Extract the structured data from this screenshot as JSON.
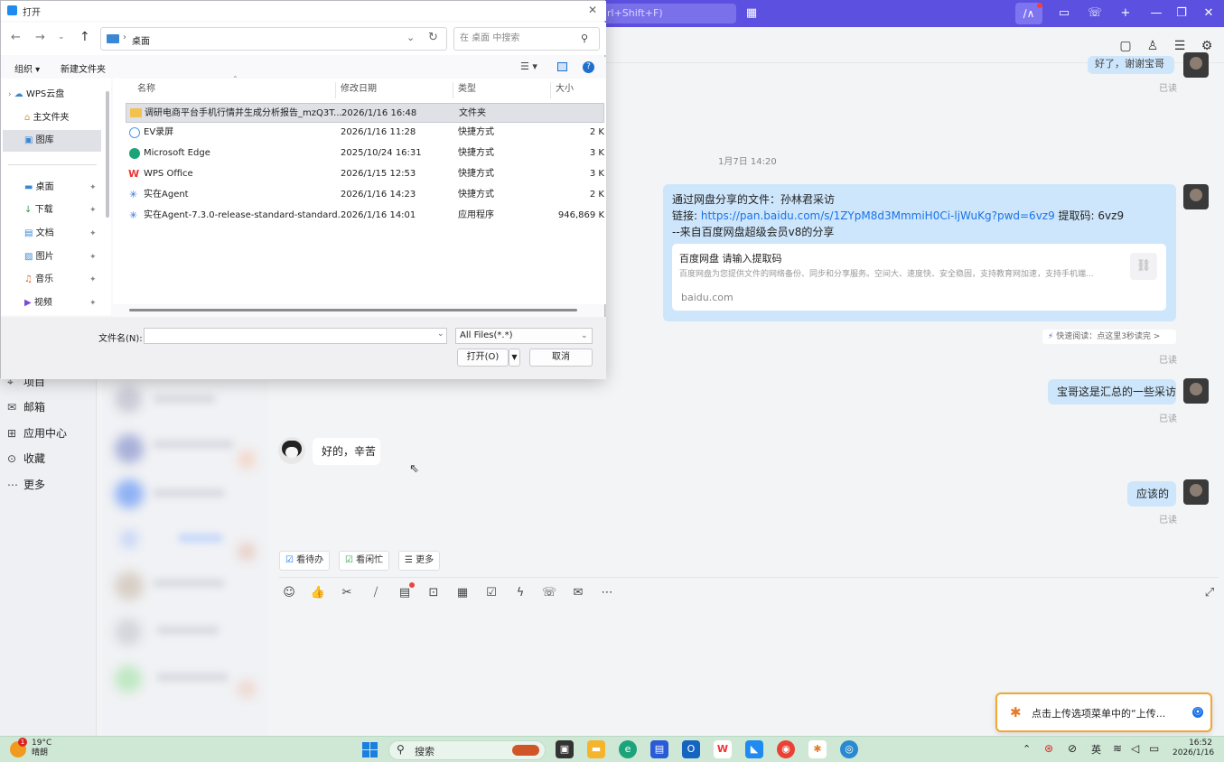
{
  "app": {
    "search_hint": "rl+Shift+F)",
    "sidebar": [
      {
        "label": "项目",
        "icon": "tag-icon"
      },
      {
        "label": "邮箱",
        "icon": "mail-icon"
      },
      {
        "label": "应用中心",
        "icon": "apps-icon"
      },
      {
        "label": "收藏",
        "icon": "star-icon"
      },
      {
        "label": "更多",
        "icon": "more-icon"
      }
    ],
    "partial_top_msg": "好了，谢谢宝哥",
    "read_label": "已读",
    "timestamp": "1月7日 14:20",
    "share_msg": {
      "line1": "通过网盘分享的文件：孙林君采访",
      "link_prefix": "链接: ",
      "link_url": "https://pan.baidu.com/s/1ZYpM8d3MmmiH0Ci-ljWuKg?pwd=6vz9",
      "code": " 提取码: 6vz9",
      "line3": "--来自百度网盘超级会员v8的分享",
      "card_title": "百度网盘 请输入提取码",
      "card_desc": "百度网盘为您提供文件的网络备份、同步和分享服务。空间大、速度快、安全稳固，支持教育网加速，支持手机端...",
      "card_domain": "baidu.com"
    },
    "quick_read": "快速阅读：点这里3秒读完 >",
    "msg_summary": "宝哥这是汇总的一些采访",
    "msg_reply": "好的，辛苦",
    "msg_should": "应该的",
    "tags": [
      "看待办",
      "看闲忙",
      "更多"
    ],
    "toast": "点击上传选项菜单中的“上传..."
  },
  "dialog": {
    "title": "打开",
    "address": "桌面",
    "search_placeholder": "在 桌面 中搜索",
    "organize": "组织 ▾",
    "new_folder": "新建文件夹",
    "tree": [
      {
        "label": "WPS云盘",
        "icon": "cloud-icon"
      },
      {
        "label": "主文件夹",
        "icon": "home-icon"
      },
      {
        "label": "图库",
        "icon": "gallery-icon"
      },
      {
        "label": "桌面",
        "icon": "desktop-icon"
      },
      {
        "label": "下载",
        "icon": "download-icon"
      },
      {
        "label": "文档",
        "icon": "document-icon"
      },
      {
        "label": "图片",
        "icon": "picture-icon"
      },
      {
        "label": "音乐",
        "icon": "music-icon"
      },
      {
        "label": "视频",
        "icon": "video-icon"
      }
    ],
    "columns": [
      "名称",
      "修改日期",
      "类型",
      "大小"
    ],
    "files": [
      {
        "name": "调研电商平台手机行情并生成分析报告_mzQ3T...",
        "date": "2026/1/16 16:48",
        "type": "文件夹",
        "size": "",
        "icon": "folder-icon",
        "color": "#f2c14e"
      },
      {
        "name": "EV录屏",
        "date": "2026/1/16 11:28",
        "type": "快捷方式",
        "size": "2 K",
        "icon": "ev-icon",
        "color": "#4a9be8"
      },
      {
        "name": "Microsoft Edge",
        "date": "2025/10/24 16:31",
        "type": "快捷方式",
        "size": "3 K",
        "icon": "edge-icon",
        "color": "#1ba37a"
      },
      {
        "name": "WPS Office",
        "date": "2026/1/15 12:53",
        "type": "快捷方式",
        "size": "3 K",
        "icon": "wps-icon",
        "color": "#e33"
      },
      {
        "name": "实在Agent",
        "date": "2026/1/16 14:23",
        "type": "快捷方式",
        "size": "2 K",
        "icon": "agent-icon",
        "color": "#3b6fe0"
      },
      {
        "name": "实在Agent-7.3.0-release-standard-standard...",
        "date": "2026/1/16 14:01",
        "type": "应用程序",
        "size": "946,869 K",
        "icon": "agent-icon",
        "color": "#3b6fe0"
      }
    ],
    "filename_label": "文件名(N):",
    "filename_value": "",
    "filter": "All Files(*.*)",
    "open_btn": "打开(O)",
    "cancel_btn": "取消"
  },
  "taskbar": {
    "weather_temp": "19°C",
    "weather_desc": "晴朗",
    "weather_badge": "1",
    "search": "搜索",
    "lang": "英",
    "time": "16:52",
    "date": "2026/1/16"
  }
}
